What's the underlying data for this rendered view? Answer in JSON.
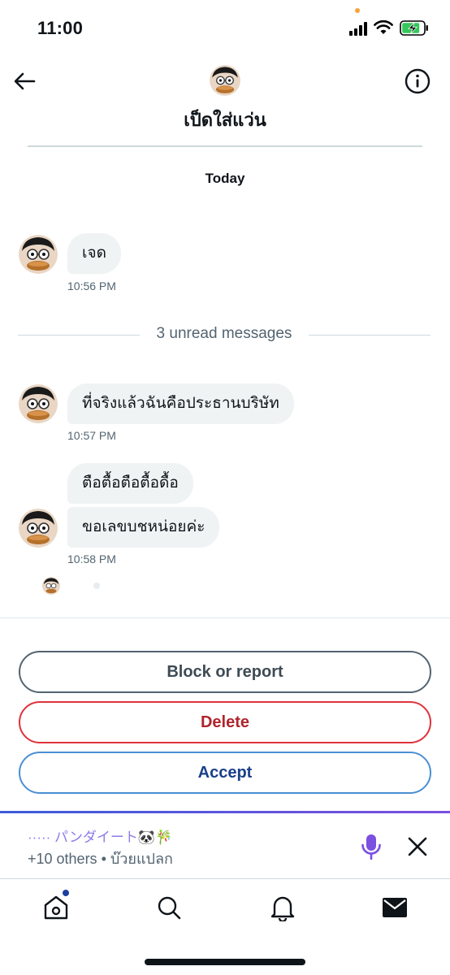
{
  "status_bar": {
    "time": "11:00"
  },
  "header": {
    "title": "เป็ดใส่แว่น",
    "back_icon": "arrow-left-icon",
    "info_icon": "info-circle-icon"
  },
  "conversation": {
    "date_separator": "Today",
    "unread_separator": "3 unread messages",
    "messages": [
      {
        "text": "เจด",
        "time": "10:56 PM"
      },
      {
        "text": "ที่จริงแล้วฉันคือประธานบริษัท",
        "time": "10:57 PM"
      },
      {
        "text": "ตือตื้อตือตื้อดื้อ",
        "time": ""
      },
      {
        "text": "ขอเลขบชหน่อยค่ะ",
        "time": "10:58 PM"
      }
    ]
  },
  "request_actions": {
    "block_label": "Block or report",
    "delete_label": "Delete",
    "accept_label": "Accept"
  },
  "spaces": {
    "host_line": "····· パンダイート🐼🎋",
    "listeners_line": "+10 others • บ๊วยแปลก",
    "accent_color": "#7b4fe0"
  },
  "tab_bar": {
    "items": [
      "home-icon",
      "search-icon",
      "notifications-icon",
      "messages-icon"
    ]
  },
  "colors": {
    "bubble": "#eff3f4",
    "delete": "#e0313b",
    "accept": "#4a8fd4"
  }
}
